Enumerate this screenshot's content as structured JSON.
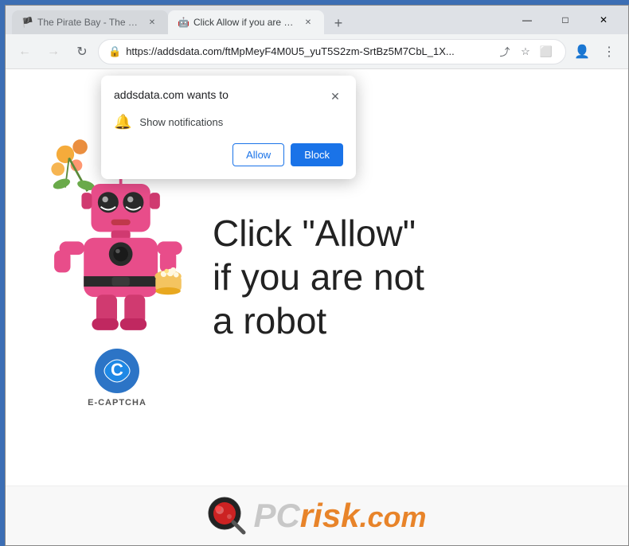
{
  "browser": {
    "tabs": [
      {
        "id": "tab1",
        "title": "The Pirate Bay - The galaxy's mo",
        "favicon": "🏴",
        "active": false
      },
      {
        "id": "tab2",
        "title": "Click Allow if you are not a robot",
        "favicon": "🤖",
        "active": true
      }
    ],
    "new_tab_label": "+",
    "window_controls": {
      "minimize": "—",
      "maximize": "□",
      "close": "✕"
    },
    "nav": {
      "back": "←",
      "forward": "→",
      "refresh": "↻",
      "url": "https://addsdata.com/ftMpMeyF4M0U5_yuT5S2zm-SrtBz5M7CbL_1X...",
      "share_icon": "⬆",
      "bookmark_icon": "☆",
      "split_icon": "⬜",
      "profile_icon": "👤",
      "menu_icon": "⋮"
    }
  },
  "notification_popup": {
    "title": "addsdata.com wants to",
    "close_icon": "✕",
    "bell_icon": "🔔",
    "notification_label": "Show notifications",
    "allow_button": "Allow",
    "block_button": "Block"
  },
  "website": {
    "main_text_line1": "Click \"Allow\"",
    "main_text_line2": "if you are not",
    "main_text_line3": "a robot",
    "captcha_label": "E-CAPTCHA"
  },
  "pcrisk": {
    "pc_text": "PC",
    "risk_text": "risk",
    "com_text": ".com"
  },
  "colors": {
    "allow_button_border": "#1a73e8",
    "allow_button_text": "#1a73e8",
    "block_button_bg": "#1a73e8",
    "block_button_text": "#ffffff",
    "pcrisk_orange": "#e8842a",
    "pcrisk_gray": "#c8c8c8"
  }
}
